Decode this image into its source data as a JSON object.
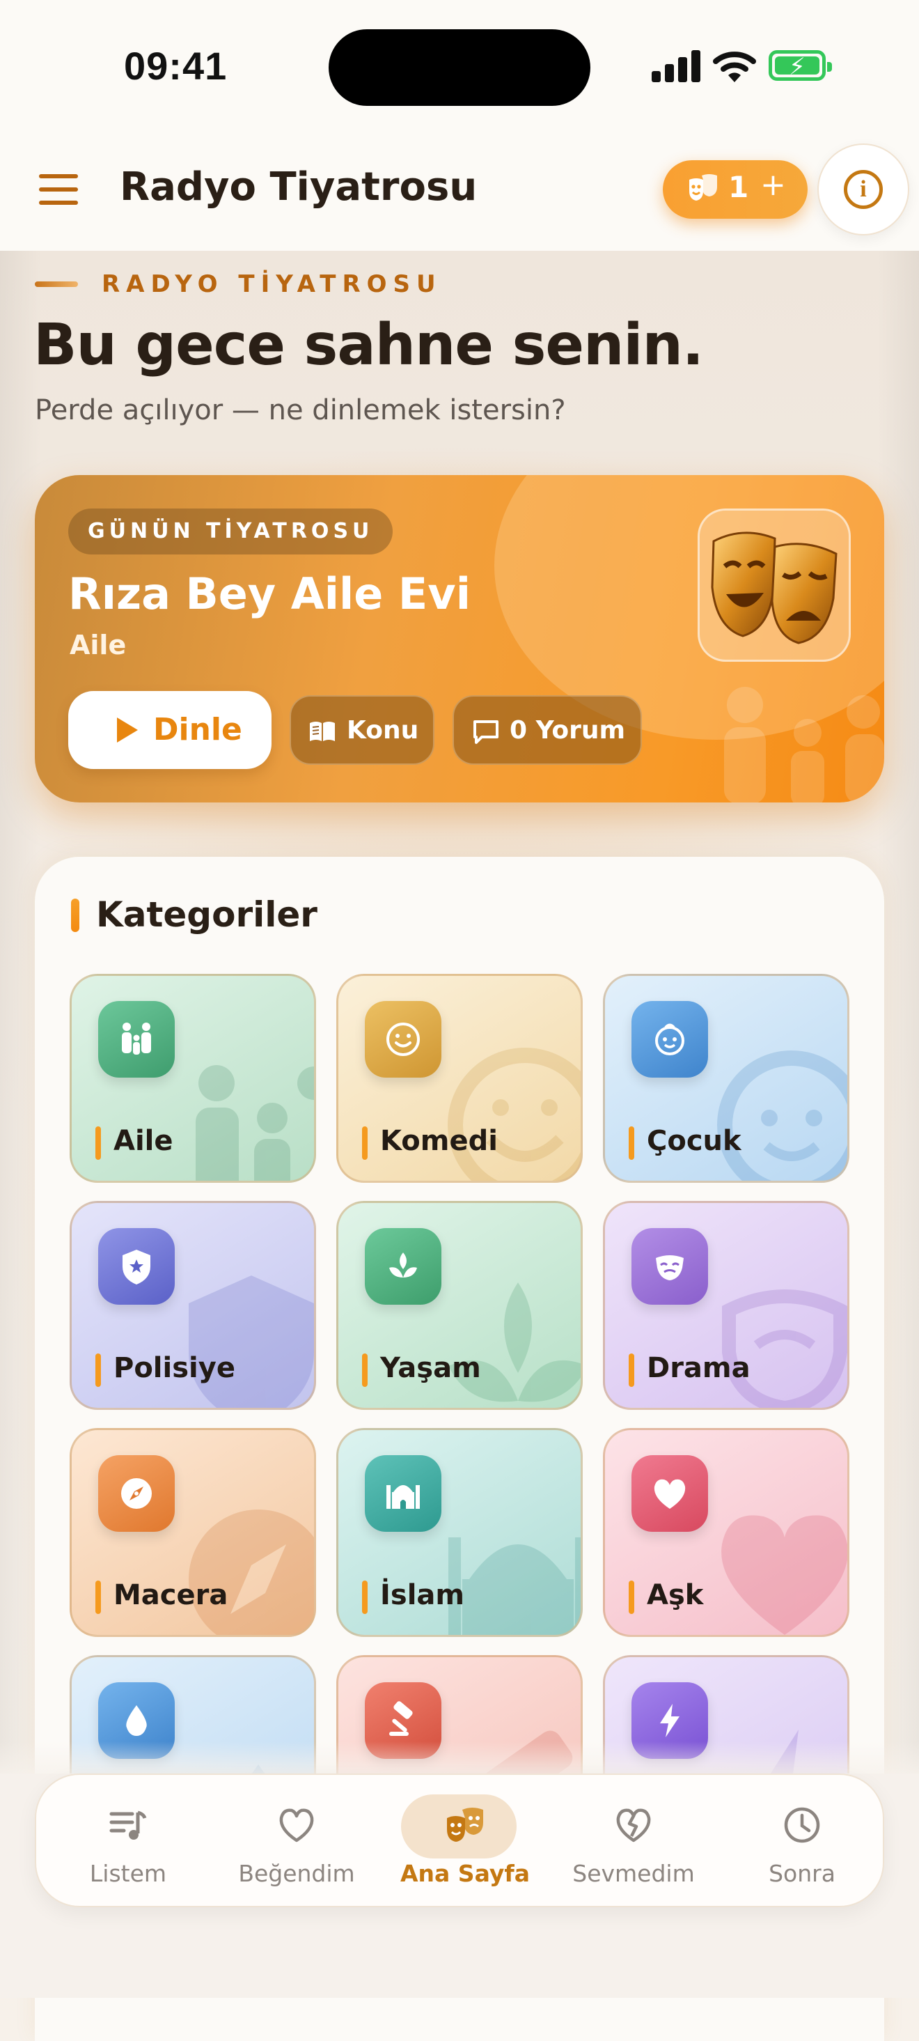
{
  "status_bar": {
    "time": "09:41"
  },
  "header": {
    "title": "Radyo Tiyatrosu",
    "credits": {
      "count": "1",
      "plus": "+"
    }
  },
  "hero": {
    "eyebrow": "RADYO TİYATROSU",
    "headline": "Bu gece sahne senin.",
    "subtitle": "Perde açılıyor — ne dinlemek istersin?"
  },
  "featured": {
    "badge": "GÜNÜN TİYATROSU",
    "title": "Rıza Bey Aile Evi",
    "genre": "Aile",
    "play_label": "Dinle",
    "topic_label": "Konu",
    "comments_label": "0 Yorum"
  },
  "categories": {
    "title": "Kategoriler",
    "items": [
      {
        "label": "Aile",
        "icon": "family-icon",
        "color": "#4fae7e"
      },
      {
        "label": "Komedi",
        "icon": "smiley-icon",
        "color": "#d9a441"
      },
      {
        "label": "Çocuk",
        "icon": "child-face-icon",
        "color": "#4b95d8"
      },
      {
        "label": "Polisiye",
        "icon": "police-badge-icon",
        "color": "#6a6fcf"
      },
      {
        "label": "Yaşam",
        "icon": "sprout-icon",
        "color": "#49a774"
      },
      {
        "label": "Drama",
        "icon": "drama-mask-icon",
        "color": "#9a6ad0"
      },
      {
        "label": "Macera",
        "icon": "compass-icon",
        "color": "#e58a3e"
      },
      {
        "label": "İslam",
        "icon": "mosque-icon",
        "color": "#3aa79f"
      },
      {
        "label": "Aşk",
        "icon": "heart-icon",
        "color": "#e0566f"
      },
      {
        "label": "",
        "icon": "water-drop-icon",
        "color": "#4b95d8"
      },
      {
        "label": "",
        "icon": "gavel-icon",
        "color": "#e05a4a"
      },
      {
        "label": "",
        "icon": "lightning-icon",
        "color": "#8a62d6"
      }
    ]
  },
  "bottom_nav": {
    "items": [
      {
        "label": "Listem",
        "icon": "playlist-icon"
      },
      {
        "label": "Beğendim",
        "icon": "heart-outline-icon"
      },
      {
        "label": "Ana Sayfa",
        "icon": "theater-masks-icon",
        "active": true
      },
      {
        "label": "Sevmedim",
        "icon": "broken-heart-icon"
      },
      {
        "label": "Sonra",
        "icon": "clock-icon"
      }
    ]
  },
  "colors": {
    "accent": "#f39a22",
    "brand_brown": "#b8650f"
  }
}
